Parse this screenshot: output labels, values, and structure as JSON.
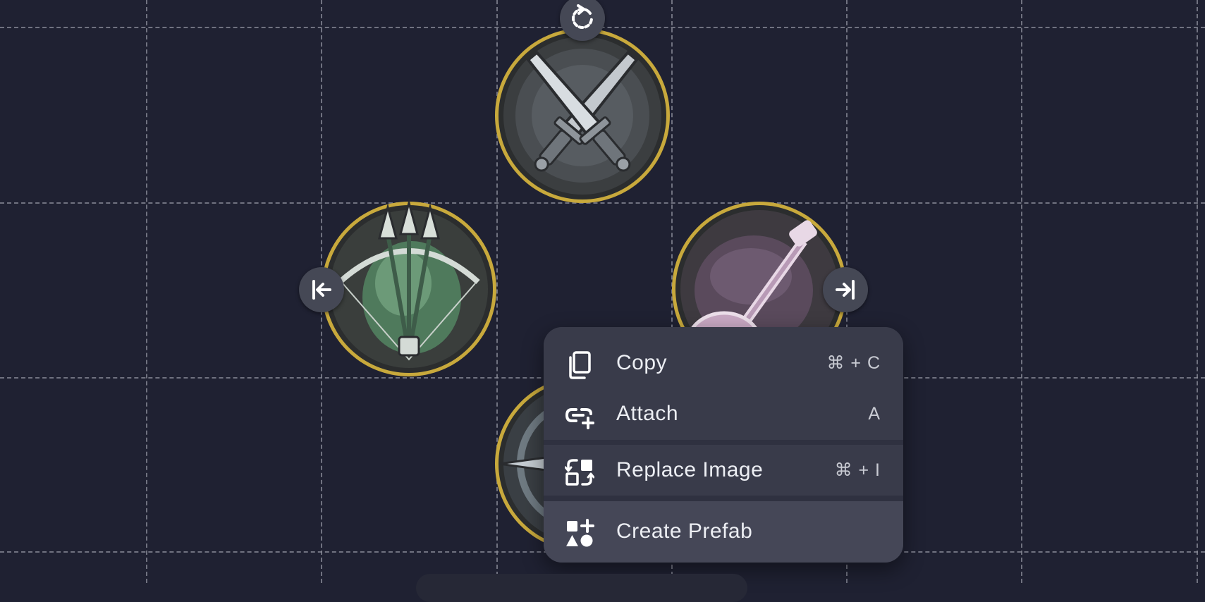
{
  "canvas": {
    "background": "#1f2132",
    "grid_color": "#8c8e9a"
  },
  "tokens": [
    {
      "name": "crossed-daggers",
      "icon": "crossed-daggers-icon",
      "ring_color": "#c8a93c",
      "selected": true
    },
    {
      "name": "crossbow",
      "icon": "crossbow-icon",
      "ring_color": "#c8a93c"
    },
    {
      "name": "lute",
      "icon": "lute-icon",
      "ring_color": "#c8a93c"
    },
    {
      "name": "compass",
      "icon": "compass-icon",
      "ring_color": "#c8a93c"
    }
  ],
  "handles": {
    "rotate": {
      "icon": "rotate-icon"
    },
    "left": {
      "icon": "move-left-bar-icon"
    },
    "right": {
      "icon": "move-right-bar-icon"
    }
  },
  "context_menu": {
    "items": [
      {
        "label": "Copy",
        "shortcut": "⌘ + C",
        "icon": "copy-icon"
      },
      {
        "label": "Attach",
        "shortcut": "A",
        "icon": "attach-link-icon"
      },
      {
        "label": "Replace Image",
        "shortcut": "⌘ + I",
        "icon": "replace-image-icon"
      },
      {
        "label": "Create Prefab",
        "shortcut": "",
        "icon": "shapes-plus-icon"
      }
    ],
    "hover_index": 3
  }
}
